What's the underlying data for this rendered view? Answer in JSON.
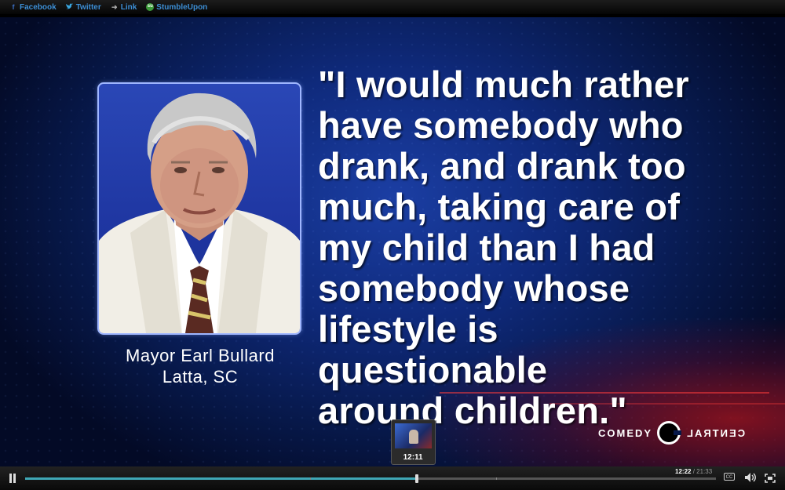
{
  "share_bar": {
    "items": [
      {
        "label": "Facebook",
        "icon": "facebook-icon",
        "glyph": "f"
      },
      {
        "label": "Twitter",
        "icon": "twitter-icon",
        "glyph": "t"
      },
      {
        "label": "Link",
        "icon": "link-icon",
        "glyph": "➜"
      },
      {
        "label": "StumbleUpon",
        "icon": "stumbleupon-icon",
        "glyph": "su"
      }
    ]
  },
  "video": {
    "quote": "\"I would much rather\nhave somebody who\ndrank, and drank too\nmuch, taking care of\nmy child than I had\nsomebody whose\nlifestyle is questionable\naround children.\"",
    "caption_name": "Mayor Earl Bullard",
    "caption_place": "Latta, SC",
    "network_left": "COMEDY",
    "network_right": "CENTRAL"
  },
  "player": {
    "thumbnail_time": "12:11",
    "current_time": "12:22",
    "separator": " / ",
    "total_time": "21:33",
    "progress_fraction": 0.5669,
    "preview_fraction": 0.5615,
    "chapter_fractions": [
      0.412,
      0.682
    ],
    "cc_label": "CC",
    "accent_color": "#3fa7b5"
  }
}
